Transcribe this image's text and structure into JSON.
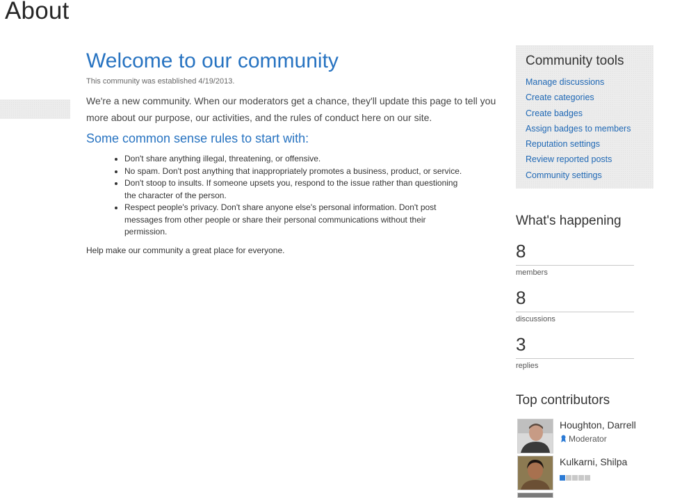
{
  "page": {
    "title": "About"
  },
  "main": {
    "heading": "Welcome to our community",
    "established": "This community was established 4/19/2013.",
    "intro": "We're a new community. When our moderators get a chance, they'll update this page to tell you more about our purpose, our activities, and the rules of conduct here on our site.",
    "rules_heading": "Some common sense rules to start with:",
    "rules": [
      "Don't share anything illegal, threatening, or offensive.",
      "No spam. Don't post anything that inappropriately promotes a business, product, or service.",
      "Don't stoop to insults. If someone upsets you, respond to the issue rather than questioning the character of the person.",
      "Respect people's privacy. Don't share anyone else's personal information. Don't post messages from other people or share their personal communications without their permission."
    ],
    "closing": "Help make our community a great place for everyone."
  },
  "tools": {
    "title": "Community tools",
    "links": [
      "Manage discussions",
      "Create categories",
      "Create badges",
      "Assign badges to members",
      "Reputation settings",
      "Review reported posts",
      "Community settings"
    ]
  },
  "happening": {
    "title": "What's happening",
    "stats": [
      {
        "value": "8",
        "label": "members"
      },
      {
        "value": "8",
        "label": "discussions"
      },
      {
        "value": "3",
        "label": "replies"
      }
    ]
  },
  "contributors": {
    "title": "Top contributors",
    "people": [
      {
        "name": "Houghton, Darrell",
        "role": "Moderator",
        "role_icon": "ribbon-badge-icon"
      },
      {
        "name": "Kulkarni, Shilpa",
        "level": 1,
        "level_max": 5
      }
    ]
  },
  "colors": {
    "accent": "#2773c1",
    "link": "#1f68b5",
    "level_on": "#2c7bd5",
    "level_off": "#c9c9c9"
  }
}
